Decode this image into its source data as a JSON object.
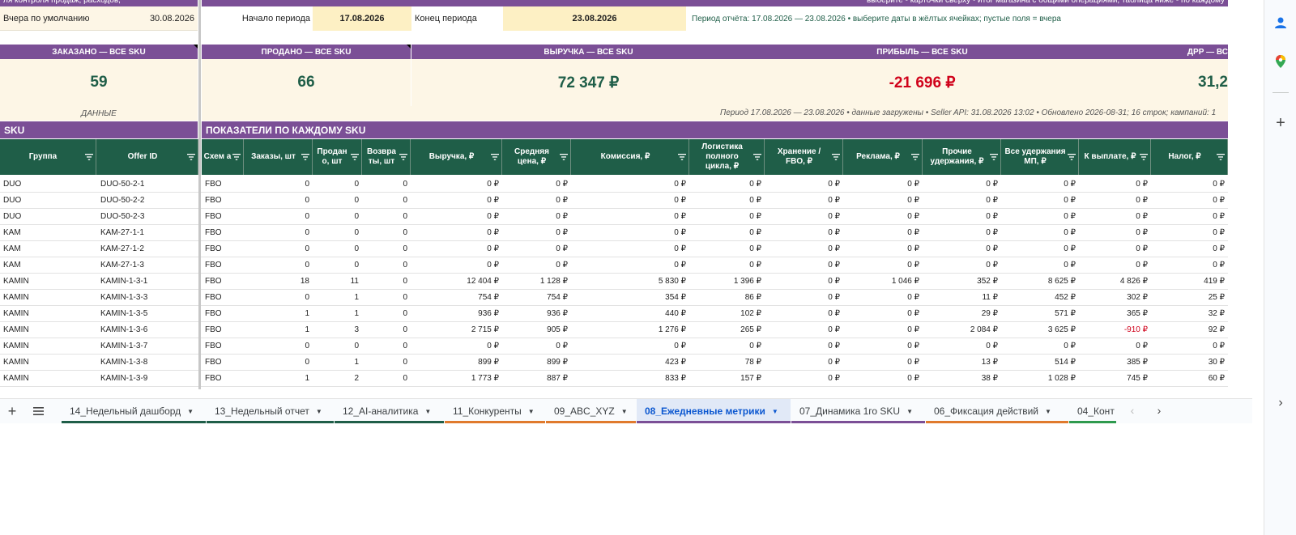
{
  "top": {
    "left_text": "ля контроля продаж, расходов,",
    "right_text": "выберите - карточки сверху - итог магазина с общими операциями, таблица ниже - по каждому"
  },
  "defaults": {
    "label": "Вчера по умолчанию",
    "date": "30.08.2026"
  },
  "period": {
    "start_label": "Начало периода",
    "start_value": "17.08.2026",
    "end_label": "Конец периода",
    "end_value": "23.08.2026",
    "hint": "Период отчёта: 17.08.2026 — 23.08.2026  •  выберите даты в жёлтых ячейках; пустые поля = вчера"
  },
  "kpis": [
    {
      "label": "ЗАКАЗАНО — ВСЕ SKU",
      "value": "59"
    },
    {
      "label": "ПРОДАНО — ВСЕ SKU",
      "value": "66"
    },
    {
      "label": "ВЫРУЧКА — ВСЕ SKU",
      "value": "72 347 ₽"
    },
    {
      "label": "ПРИБЫЛЬ — ВСЕ SKU",
      "value": "-21 696 ₽"
    },
    {
      "label": "ДРР — ВС",
      "value": "31,2"
    }
  ],
  "status": {
    "data_label": "ДАННЫЕ",
    "text": "Период 17.08.2026 — 23.08.2026  •  данные загружены  •  Seller API: 31.08.2026 13:02  •  Обновлено 2026-08-31; 16 строк; кампаний: 1"
  },
  "sections": {
    "sku": "SKU",
    "metrics": "ПОКАЗАТЕЛИ ПО КАЖДОМУ SKU"
  },
  "columns": [
    "Группа",
    "Offer ID",
    "Схем а",
    "Заказы, шт",
    "Продан о, шт",
    "Возвра ты, шт",
    "Выручка, ₽",
    "Средняя цена, ₽",
    "Комиссия, ₽",
    "Логистика полного цикла, ₽",
    "Хранение / FBO, ₽",
    "Реклама, ₽",
    "Прочие удержания, ₽",
    "Все удержания МП, ₽",
    "К выплате, ₽",
    "Налог, ₽"
  ],
  "rows": [
    [
      "DUO",
      "DUO-50-2-1",
      "FBO",
      "0",
      "0",
      "0",
      "0 ₽",
      "0 ₽",
      "0 ₽",
      "0 ₽",
      "0 ₽",
      "0 ₽",
      "0 ₽",
      "0 ₽",
      "0 ₽",
      "0 ₽"
    ],
    [
      "DUO",
      "DUO-50-2-2",
      "FBO",
      "0",
      "0",
      "0",
      "0 ₽",
      "0 ₽",
      "0 ₽",
      "0 ₽",
      "0 ₽",
      "0 ₽",
      "0 ₽",
      "0 ₽",
      "0 ₽",
      "0 ₽"
    ],
    [
      "DUO",
      "DUO-50-2-3",
      "FBO",
      "0",
      "0",
      "0",
      "0 ₽",
      "0 ₽",
      "0 ₽",
      "0 ₽",
      "0 ₽",
      "0 ₽",
      "0 ₽",
      "0 ₽",
      "0 ₽",
      "0 ₽"
    ],
    [
      "KAM",
      "KAM-27-1-1",
      "FBO",
      "0",
      "0",
      "0",
      "0 ₽",
      "0 ₽",
      "0 ₽",
      "0 ₽",
      "0 ₽",
      "0 ₽",
      "0 ₽",
      "0 ₽",
      "0 ₽",
      "0 ₽"
    ],
    [
      "KAM",
      "KAM-27-1-2",
      "FBO",
      "0",
      "0",
      "0",
      "0 ₽",
      "0 ₽",
      "0 ₽",
      "0 ₽",
      "0 ₽",
      "0 ₽",
      "0 ₽",
      "0 ₽",
      "0 ₽",
      "0 ₽"
    ],
    [
      "KAM",
      "KAM-27-1-3",
      "FBO",
      "0",
      "0",
      "0",
      "0 ₽",
      "0 ₽",
      "0 ₽",
      "0 ₽",
      "0 ₽",
      "0 ₽",
      "0 ₽",
      "0 ₽",
      "0 ₽",
      "0 ₽"
    ],
    [
      "KAMIN",
      "KAMIN-1-3-1",
      "FBO",
      "18",
      "11",
      "0",
      "12 404 ₽",
      "1 128 ₽",
      "5 830 ₽",
      "1 396 ₽",
      "0 ₽",
      "1 046 ₽",
      "352 ₽",
      "8 625 ₽",
      "4 826 ₽",
      "419 ₽"
    ],
    [
      "KAMIN",
      "KAMIN-1-3-3",
      "FBO",
      "0",
      "1",
      "0",
      "754 ₽",
      "754 ₽",
      "354 ₽",
      "86 ₽",
      "0 ₽",
      "0 ₽",
      "11 ₽",
      "452 ₽",
      "302 ₽",
      "25 ₽"
    ],
    [
      "KAMIN",
      "KAMIN-1-3-5",
      "FBO",
      "1",
      "1",
      "0",
      "936 ₽",
      "936 ₽",
      "440 ₽",
      "102 ₽",
      "0 ₽",
      "0 ₽",
      "29 ₽",
      "571 ₽",
      "365 ₽",
      "32 ₽"
    ],
    [
      "KAMIN",
      "KAMIN-1-3-6",
      "FBO",
      "1",
      "3",
      "0",
      "2 715 ₽",
      "905 ₽",
      "1 276 ₽",
      "265 ₽",
      "0 ₽",
      "0 ₽",
      "2 084 ₽",
      "3 625 ₽",
      "-910 ₽",
      "92 ₽"
    ],
    [
      "KAMIN",
      "KAMIN-1-3-7",
      "FBO",
      "0",
      "0",
      "0",
      "0 ₽",
      "0 ₽",
      "0 ₽",
      "0 ₽",
      "0 ₽",
      "0 ₽",
      "0 ₽",
      "0 ₽",
      "0 ₽",
      "0 ₽"
    ],
    [
      "KAMIN",
      "KAMIN-1-3-8",
      "FBO",
      "0",
      "1",
      "0",
      "899 ₽",
      "899 ₽",
      "423 ₽",
      "78 ₽",
      "0 ₽",
      "0 ₽",
      "13 ₽",
      "514 ₽",
      "385 ₽",
      "30 ₽"
    ],
    [
      "KAMIN",
      "KAMIN-1-3-9",
      "FBO",
      "1",
      "2",
      "0",
      "1 773 ₽",
      "887 ₽",
      "833 ₽",
      "157 ₽",
      "0 ₽",
      "0 ₽",
      "38 ₽",
      "1 028 ₽",
      "745 ₽",
      "60 ₽"
    ]
  ],
  "tabs": [
    {
      "label": "14_Недельный дашборд",
      "color": "#1f5e48"
    },
    {
      "label": "13_Недельный отчет",
      "color": "#1f5e48"
    },
    {
      "label": "12_AI-аналитика",
      "color": "#1f5e48"
    },
    {
      "label": "11_Конкуренты",
      "color": "#e07a2d"
    },
    {
      "label": "09_ABC_XYZ",
      "color": "#e07a2d"
    },
    {
      "label": "08_Ежедневные метрики",
      "color": "#7b4f96",
      "active": true
    },
    {
      "label": "07_Динамика 1го SKU",
      "color": "#7b4f96"
    },
    {
      "label": "06_Фиксация действий",
      "color": "#e07a2d"
    },
    {
      "label": "04_Конт",
      "color": "#2e9a4e"
    }
  ],
  "colors": {
    "purple": "#7b4f96",
    "dark_green": "#1f5e48",
    "negative": "#d0021b",
    "active_tab": "#0b57d0"
  }
}
